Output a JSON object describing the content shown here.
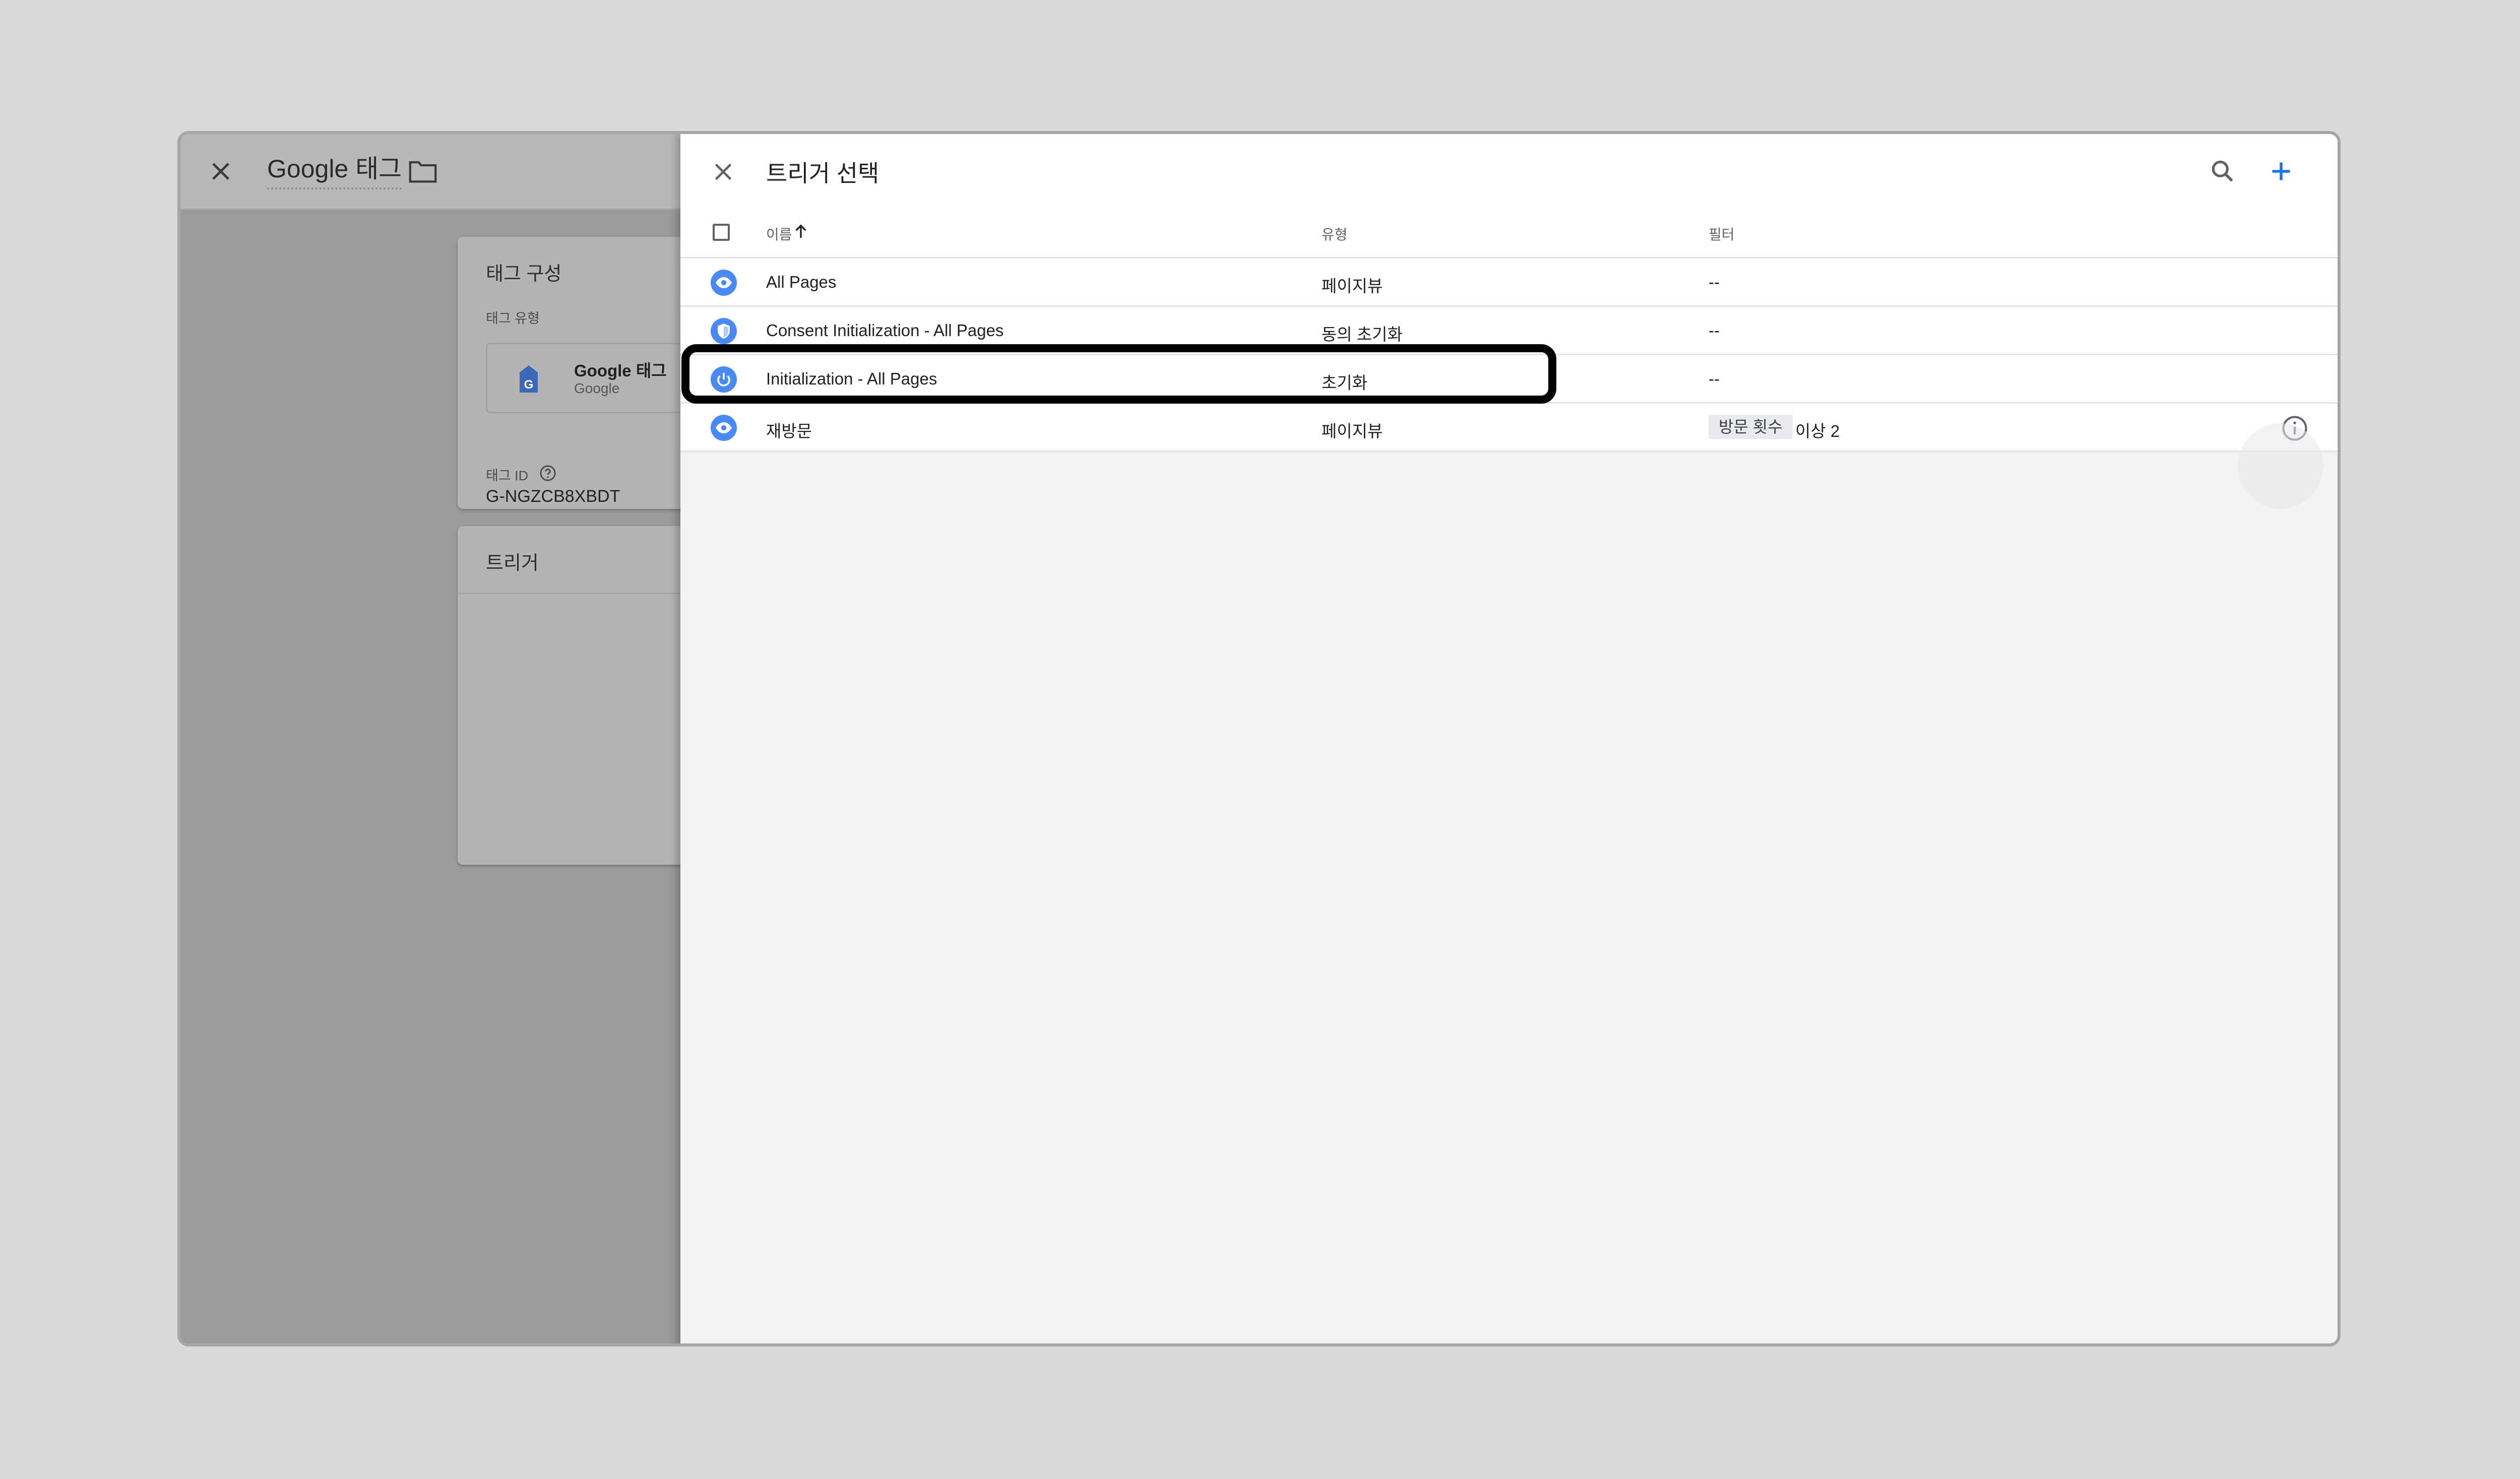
{
  "background": {
    "title": "Google 태그",
    "config_card": {
      "title": "태그 구성",
      "tag_type_label": "태그 유형",
      "tag_type_name": "Google 태그",
      "tag_type_vendor": "Google",
      "tag_id_label": "태그 ID",
      "tag_id_value": "G-NGZCB8XBDT"
    },
    "trigger_card": {
      "title": "트리거"
    }
  },
  "panel": {
    "title": "트리거 선택",
    "columns": {
      "name": "이름",
      "type": "유형",
      "filter": "필터"
    },
    "rows": [
      {
        "name": "All Pages",
        "type": "페이지뷰",
        "filter": "--",
        "icon": "eye-icon"
      },
      {
        "name": "Consent Initialization - All Pages",
        "type": "동의 초기화",
        "filter": "--",
        "icon": "shield-icon"
      },
      {
        "name": "Initialization - All Pages",
        "type": "초기화",
        "filter": "--",
        "icon": "power-icon"
      },
      {
        "name": "재방문",
        "type": "페이지뷰",
        "filter_chip": "방문 횟수",
        "filter_value": "이상 2",
        "icon": "eye-icon"
      }
    ]
  },
  "colors": {
    "accent": "#4a8af4",
    "highlight_border": "#000000",
    "panel_background": "#f1f3f4"
  }
}
